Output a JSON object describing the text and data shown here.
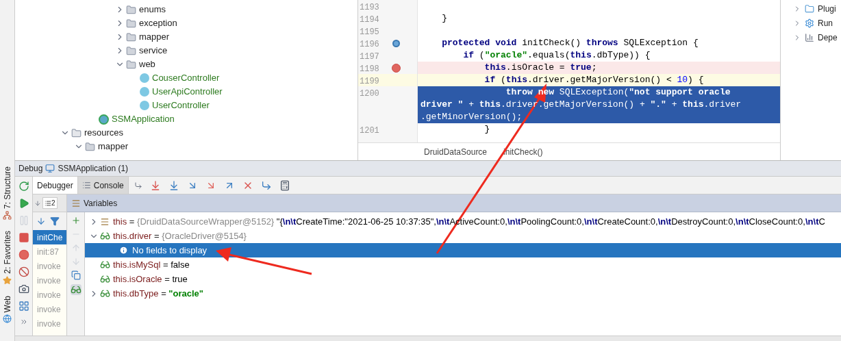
{
  "side_tools": [
    {
      "label": "7: Structure",
      "kind": "structure"
    },
    {
      "label": "2: Favorites",
      "kind": "favorites"
    },
    {
      "label": "Web",
      "kind": "web"
    }
  ],
  "tree": [
    {
      "children": [
        {
          "children": [
            {
              "children": [
                {
                  "children": [
                    {
                      "label": "enums",
                      "kind": "folder",
                      "expanded": false
                    },
                    {
                      "label": "exception",
                      "kind": "folder",
                      "expanded": false
                    },
                    {
                      "label": "mapper",
                      "kind": "folder",
                      "expanded": false
                    },
                    {
                      "label": "service",
                      "kind": "folder",
                      "expanded": false
                    },
                    {
                      "label": "web",
                      "kind": "folder",
                      "expanded": true,
                      "children": [
                        {
                          "label": "CouserController",
                          "kind": "class"
                        },
                        {
                          "label": "UserApiController",
                          "kind": "class"
                        },
                        {
                          "label": "UserController",
                          "kind": "class"
                        }
                      ]
                    }
                  ]
                }
              ]
            },
            {
              "label": "SSMApplication",
              "kind": "app"
            }
          ]
        }
      ]
    },
    {
      "label": "resources",
      "kind": "resources",
      "expanded": true,
      "children": [
        {
          "label": "mapper",
          "kind": "folder",
          "expanded": true
        }
      ]
    }
  ],
  "editor": {
    "lines": [
      {
        "number": "1193",
        "breakpoint": false,
        "method_breakpoint": false,
        "current": false,
        "selected": false
      },
      {
        "number": "1194",
        "breakpoint": false,
        "method_breakpoint": false,
        "current": false,
        "selected": false,
        "tokens": [
          {
            "kind": "plain",
            "text": "    }"
          }
        ]
      },
      {
        "number": "1195",
        "breakpoint": false,
        "method_breakpoint": false,
        "current": false,
        "selected": false
      },
      {
        "number": "1196",
        "breakpoint": false,
        "method_breakpoint": true,
        "current": false,
        "selected": false,
        "tokens": [
          {
            "kind": "kw",
            "text": "    protected void "
          },
          {
            "kind": "plain",
            "text": "initCheck() "
          },
          {
            "kind": "kw",
            "text": "throws "
          },
          {
            "kind": "plain",
            "text": "SQLException {"
          }
        ]
      },
      {
        "number": "1197",
        "breakpoint": false,
        "method_breakpoint": false,
        "current": false,
        "selected": false,
        "tokens": [
          {
            "kind": "kw",
            "text": "        if "
          },
          {
            "kind": "plain",
            "text": "("
          },
          {
            "kind": "str",
            "text": "\"oracle\""
          },
          {
            "kind": "plain",
            "text": ".equals("
          },
          {
            "kind": "kw",
            "text": "this"
          },
          {
            "kind": "plain",
            "text": ".dbType)) {"
          }
        ]
      },
      {
        "number": "1198",
        "breakpoint": true,
        "method_breakpoint": false,
        "current": false,
        "selected": false,
        "tokens": [
          {
            "kind": "kw",
            "text": "            this"
          },
          {
            "kind": "plain",
            "text": ".isOracle = "
          },
          {
            "kind": "kw",
            "text": "true"
          },
          {
            "kind": "plain",
            "text": ";"
          }
        ]
      },
      {
        "number": "1199",
        "breakpoint": false,
        "method_breakpoint": false,
        "current": true,
        "selected": false,
        "tokens": [
          {
            "kind": "kw",
            "text": "            if "
          },
          {
            "kind": "plain",
            "text": "("
          },
          {
            "kind": "kw",
            "text": "this"
          },
          {
            "kind": "plain",
            "text": ".driver.getMajorVersion() < "
          },
          {
            "kind": "num",
            "text": "10"
          },
          {
            "kind": "plain",
            "text": ") {"
          }
        ]
      },
      {
        "number": "1200",
        "breakpoint": false,
        "method_breakpoint": false,
        "current": false,
        "selected": true,
        "tokens": [
          {
            "kind": "kw",
            "text": "                throw new "
          },
          {
            "kind": "plain",
            "text": "SQLException("
          },
          {
            "kind": "str",
            "text": "\"not support oracle"
          }
        ]
      },
      {
        "breakpoint": false,
        "method_breakpoint": false,
        "current": false,
        "selected": true,
        "tokens": [
          {
            "kind": "str",
            "text": "driver \" "
          },
          {
            "kind": "plain",
            "text": "+ "
          },
          {
            "kind": "kw",
            "text": "this"
          },
          {
            "kind": "plain",
            "text": ".driver.getMajorVersion() + "
          },
          {
            "kind": "str",
            "text": "\".\" "
          },
          {
            "kind": "plain",
            "text": "+ "
          },
          {
            "kind": "kw",
            "text": "this"
          },
          {
            "kind": "plain",
            "text": ".driver"
          }
        ]
      },
      {
        "breakpoint": false,
        "method_breakpoint": false,
        "current": false,
        "selected": true,
        "tokens": [
          {
            "kind": "plain",
            "text": ".getMinorVersion();"
          }
        ]
      },
      {
        "number": "1201",
        "breakpoint": false,
        "method_breakpoint": false,
        "current": false,
        "selected": false,
        "tokens": [
          {
            "kind": "plain",
            "text": "            }"
          }
        ]
      }
    ],
    "breadcrumbs": [
      "DruidDataSource",
      "initCheck()"
    ]
  },
  "right_panel": [
    {
      "label": "Plugi",
      "kind": "plugins"
    },
    {
      "label": "Run",
      "kind": "run"
    },
    {
      "label": "Depe",
      "kind": "deps"
    }
  ],
  "debug": {
    "title": "Debug",
    "config": "SSMApplication (1)",
    "tabs": [
      {
        "label": "Debugger",
        "selected": true
      },
      {
        "label": "Console",
        "selected": false
      }
    ],
    "thread_count": "2",
    "variables_title": "Variables",
    "frames": [
      {
        "label": "initChe",
        "selected": true
      },
      {
        "label": "init:87",
        "selected": false
      },
      {
        "label": "invoke",
        "selected": false
      },
      {
        "label": "invoke",
        "selected": false
      },
      {
        "label": "invoke",
        "selected": false
      },
      {
        "label": "invoke",
        "selected": false
      },
      {
        "label": "invoke",
        "selected": false
      }
    ],
    "variables": [
      {
        "kind": "object",
        "expanded": false,
        "selected": false,
        "name": "this",
        "eq": "=",
        "ref": "{DruidDataSourceWrapper@5152}",
        "value": [
          {
            "kind": "plain",
            "text": "\"{"
          },
          {
            "kind": "esc",
            "text": "\\n\\t"
          },
          {
            "kind": "plain",
            "text": "CreateTime:\"2021-06-25 10:37:35\","
          },
          {
            "kind": "esc",
            "text": "\\n\\t"
          },
          {
            "kind": "plain",
            "text": "ActiveCount:0,"
          },
          {
            "kind": "esc",
            "text": "\\n\\t"
          },
          {
            "kind": "plain",
            "text": "PoolingCount:0,"
          },
          {
            "kind": "esc",
            "text": "\\n\\t"
          },
          {
            "kind": "plain",
            "text": "CreateCount:0,"
          },
          {
            "kind": "esc",
            "text": "\\n\\t"
          },
          {
            "kind": "plain",
            "text": "DestroyCount:0,"
          },
          {
            "kind": "esc",
            "text": "\\n\\t"
          },
          {
            "kind": "plain",
            "text": "CloseCount:0,"
          },
          {
            "kind": "esc",
            "text": "\\n\\t"
          },
          {
            "kind": "plain",
            "text": "C"
          }
        ]
      },
      {
        "kind": "field",
        "expanded": true,
        "selected": false,
        "name": "this.driver",
        "eq": "=",
        "ref": "{OracleDriver@5154}",
        "children": [
          {
            "kind": "message",
            "selected": true,
            "name": "No fields to display"
          }
        ]
      },
      {
        "kind": "field",
        "selected": false,
        "name": "this.isMySql",
        "eq": "=",
        "value": [
          {
            "kind": "plain",
            "text": "false"
          }
        ]
      },
      {
        "kind": "field",
        "selected": false,
        "name": "this.isOracle",
        "eq": "=",
        "value": [
          {
            "kind": "plain",
            "text": "true"
          }
        ]
      },
      {
        "kind": "field",
        "expanded": false,
        "selected": false,
        "name": "this.dbType",
        "eq": "=",
        "value": [
          {
            "kind": "str",
            "text": "\"oracle\""
          }
        ]
      }
    ]
  }
}
